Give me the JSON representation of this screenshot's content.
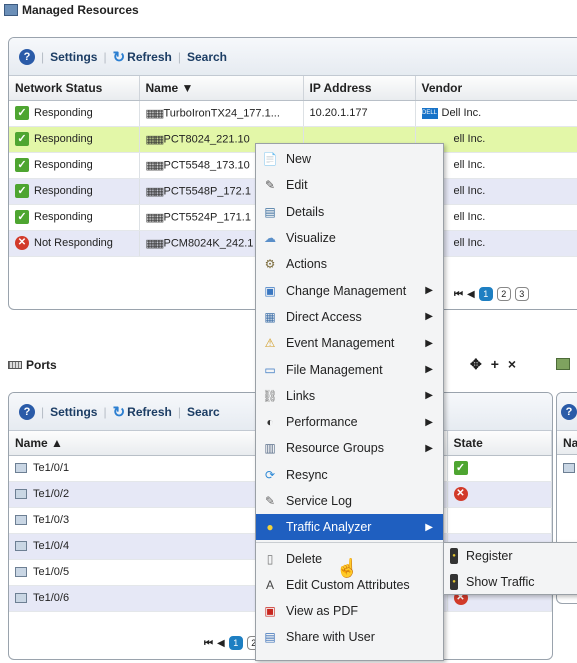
{
  "managed": {
    "title": "Managed Resources",
    "toolbar": {
      "settings": "Settings",
      "refresh": "Refresh",
      "search": "Search"
    },
    "columns": [
      "Network Status",
      "Name ▼",
      "IP Address",
      "Vendor"
    ],
    "rows": [
      {
        "status": "Responding",
        "name": "TurboIronTX24_177.1...",
        "ip": "10.20.1.177",
        "vendor": "Dell Inc."
      },
      {
        "status": "Responding",
        "name": "PCT8024_221.10",
        "ip": "",
        "vendor": "ell Inc."
      },
      {
        "status": "Responding",
        "name": "PCT5548_173.10",
        "ip": "",
        "vendor": "ell Inc."
      },
      {
        "status": "Responding",
        "name": "PCT5548P_172.1",
        "ip": "",
        "vendor": "ell Inc."
      },
      {
        "status": "Responding",
        "name": "PCT5524P_171.1",
        "ip": "",
        "vendor": "ell Inc."
      },
      {
        "status": "Not Responding",
        "name": "PCM8024K_242.1",
        "ip": "",
        "vendor": "ell Inc."
      }
    ],
    "pager": [
      "1",
      "2",
      "3"
    ],
    "dell_logo": "DELL"
  },
  "ports": {
    "title": "Ports",
    "actions": [
      "✥",
      "+",
      "×"
    ],
    "toolbar": {
      "settings": "Settings",
      "refresh": "Refresh",
      "search": "Searc"
    },
    "columns": [
      "Name ▲",
      "State"
    ],
    "rows": [
      {
        "name": "Te1/0/1",
        "state": "ok"
      },
      {
        "name": "Te1/0/2",
        "state": "bad"
      },
      {
        "name": "Te1/0/3",
        "state": ""
      },
      {
        "name": "Te1/0/4",
        "state": ""
      },
      {
        "name": "Te1/0/5",
        "state": "bad"
      },
      {
        "name": "Te1/0/6",
        "state": "bad"
      }
    ],
    "pager": [
      "1",
      "2"
    ]
  },
  "right_panel": {
    "col": "Na"
  },
  "context_menu": [
    {
      "label": "New",
      "icon": "new-icon"
    },
    {
      "label": "Edit",
      "icon": "edit-icon"
    },
    {
      "label": "Details",
      "icon": "details-icon"
    },
    {
      "label": "Visualize",
      "icon": "visualize-icon"
    },
    {
      "label": "Actions",
      "icon": "actions-icon"
    },
    {
      "label": "Change Management",
      "icon": "change-icon",
      "sub": true
    },
    {
      "label": "Direct Access",
      "icon": "direct-access-icon",
      "sub": true
    },
    {
      "label": "Event Management",
      "icon": "event-icon",
      "sub": true
    },
    {
      "label": "File Management",
      "icon": "file-icon",
      "sub": true
    },
    {
      "label": "Links",
      "icon": "links-icon",
      "sub": true
    },
    {
      "label": "Performance",
      "icon": "performance-icon",
      "sub": true
    },
    {
      "label": "Resource Groups",
      "icon": "groups-icon",
      "sub": true
    },
    {
      "label": "Resync",
      "icon": "resync-icon"
    },
    {
      "label": "Service Log",
      "icon": "log-icon"
    },
    {
      "label": "Traffic Analyzer",
      "icon": "traffic-icon",
      "sub": true,
      "highlight": true
    },
    {
      "label": "Delete",
      "icon": "delete-icon",
      "sep_before": true
    },
    {
      "label": "Edit Custom Attributes",
      "icon": "attributes-icon"
    },
    {
      "label": "View as PDF",
      "icon": "pdf-icon"
    },
    {
      "label": "Share with User",
      "icon": "share-icon"
    }
  ],
  "submenu": [
    {
      "label": "Register"
    },
    {
      "label": "Show Traffic"
    }
  ],
  "colors": {
    "highlight": "#1f5fc0",
    "selected_row": "#e3f7a8",
    "alt_row": "#e6e8f6"
  }
}
